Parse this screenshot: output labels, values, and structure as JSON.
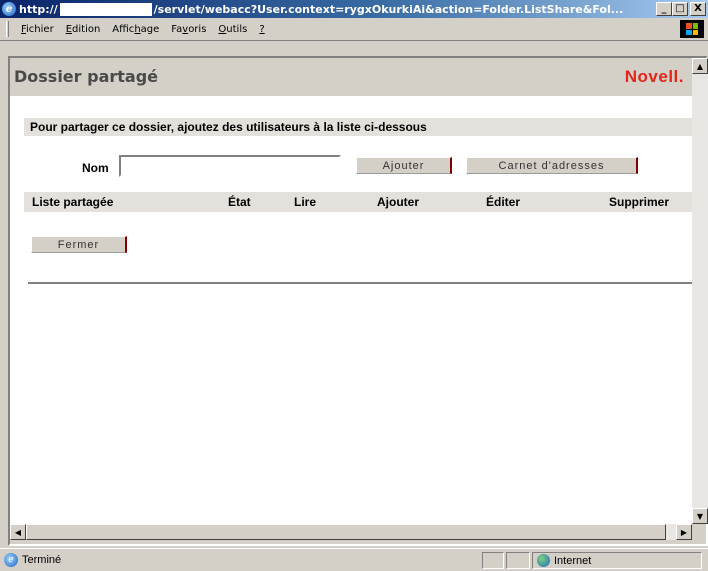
{
  "window": {
    "title_prefix": "http://",
    "title_suffix": "/servlet/webacc?User.context=rygxOkurkiAi&action=Folder.ListShare&Fol...",
    "controls": {
      "minimize": "_",
      "maximize": "□",
      "close": "X"
    }
  },
  "menubar": {
    "items": [
      {
        "pre": "",
        "u": "F",
        "post": "ichier"
      },
      {
        "pre": "",
        "u": "E",
        "post": "dition"
      },
      {
        "pre": "Affic",
        "u": "h",
        "post": "age"
      },
      {
        "pre": "Fa",
        "u": "v",
        "post": "oris"
      },
      {
        "pre": "",
        "u": "O",
        "post": "utils"
      },
      {
        "pre": "",
        "u": "?",
        "post": ""
      }
    ]
  },
  "page": {
    "title": "Dossier partagé",
    "logo": "Novell.",
    "instructions": "Pour partager ce dossier, ajoutez des utilisateurs à la liste ci-dessous",
    "nom_label": "Nom",
    "nom_value": "",
    "buttons": {
      "ajouter": "Ajouter",
      "carnet": "Carnet d'adresses",
      "fermer": "Fermer"
    },
    "table_headers": [
      "Liste partagée",
      "État",
      "Lire",
      "Ajouter",
      "Éditer",
      "Supprimer"
    ]
  },
  "statusbar": {
    "status": "Terminé",
    "zone": "Internet"
  },
  "colors": {
    "logo_red": "#e0261b",
    "title_gray": "#4a4a4a",
    "button_accent": "#800000",
    "titlebar_blue": "#0a246a"
  }
}
